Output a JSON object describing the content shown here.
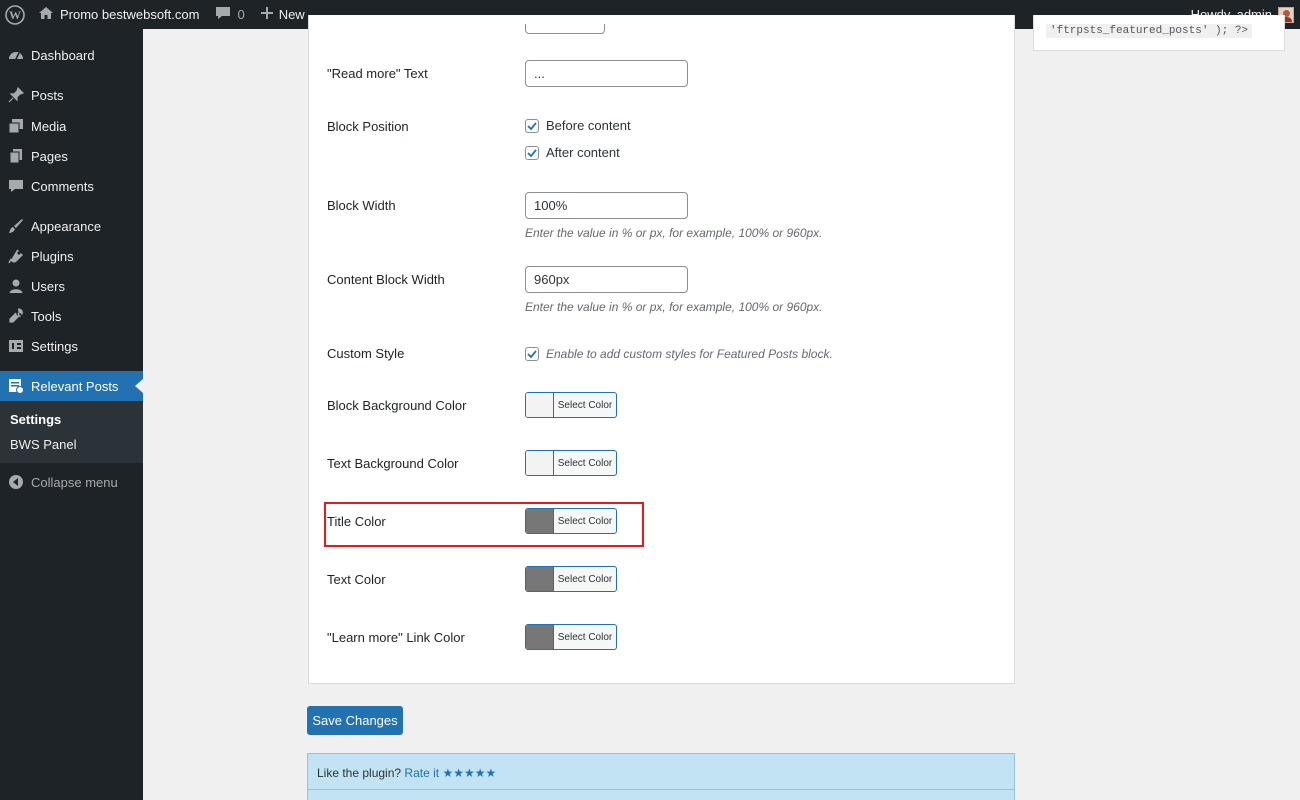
{
  "admin_bar": {
    "site_name": "Promo bestwebsoft.com",
    "comments_count": "0",
    "new_label": "New",
    "greeting": "Howdy, admin"
  },
  "sidebar": {
    "items": [
      {
        "label": "Dashboard",
        "icon": "dashboard-icon"
      },
      {
        "label": "Posts",
        "icon": "pin-icon"
      },
      {
        "label": "Media",
        "icon": "media-icon"
      },
      {
        "label": "Pages",
        "icon": "pages-icon"
      },
      {
        "label": "Comments",
        "icon": "comment-icon"
      },
      {
        "label": "Appearance",
        "icon": "brush-icon"
      },
      {
        "label": "Plugins",
        "icon": "plug-icon"
      },
      {
        "label": "Users",
        "icon": "user-icon"
      },
      {
        "label": "Tools",
        "icon": "wrench-icon"
      },
      {
        "label": "Settings",
        "icon": "settings-icon"
      },
      {
        "label": "Relevant Posts",
        "icon": "relevant-posts-icon"
      }
    ],
    "submenu": [
      "Settings",
      "BWS Panel"
    ],
    "collapse_label": "Collapse menu"
  },
  "form": {
    "read_more": {
      "label": "\"Read more\" Text",
      "value": "..."
    },
    "block_position": {
      "label": "Block Position",
      "options": [
        {
          "label": "Before content",
          "checked": true
        },
        {
          "label": "After content",
          "checked": true
        }
      ]
    },
    "block_width": {
      "label": "Block Width",
      "value": "100%",
      "hint": "Enter the value in % or px, for example, 100% or 960px."
    },
    "content_block_width": {
      "label": "Content Block Width",
      "value": "960px",
      "hint": "Enter the value in % or px, for example, 100% or 960px."
    },
    "custom_style": {
      "label": "Custom Style",
      "checked": true,
      "hint": "Enable to add custom styles for Featured Posts block."
    },
    "colors": [
      {
        "label": "Block Background Color",
        "button": "Select Color",
        "swatch": "#f3f3f3"
      },
      {
        "label": "Text Background Color",
        "button": "Select Color",
        "swatch": "#f3f3f3"
      },
      {
        "label": "Title Color",
        "button": "Select Color",
        "swatch": "#777777"
      },
      {
        "label": "Text Color",
        "button": "Select Color",
        "swatch": "#777777"
      },
      {
        "label": "\"Learn more\" Link Color",
        "button": "Select Color",
        "swatch": "#777777"
      }
    ]
  },
  "save_label": "Save Changes",
  "rate": {
    "prefix": "Like the plugin?",
    "link": "Rate it",
    "stars": "★★★★★"
  },
  "shortcode_snippet": "'ftrpsts_featured_posts' ); ?>",
  "colors_theme": {
    "admin_bg": "#1d2327",
    "accent": "#2271b1",
    "highlight": "#e21b1b"
  }
}
